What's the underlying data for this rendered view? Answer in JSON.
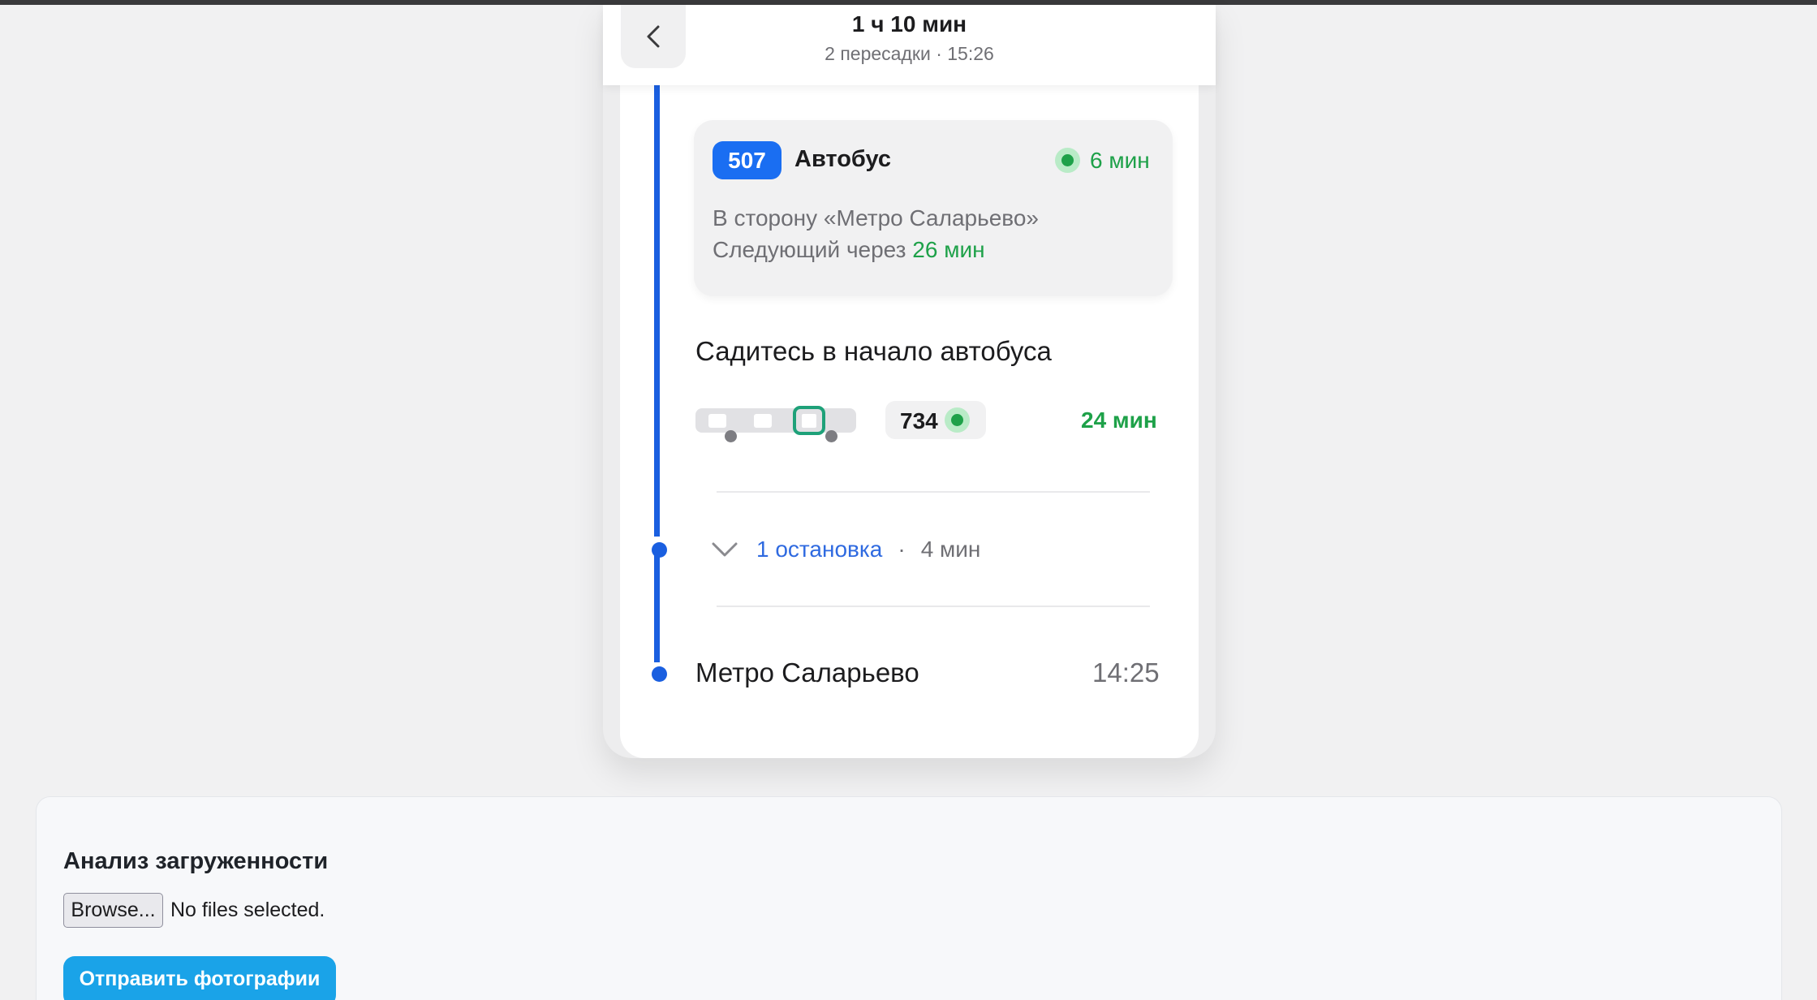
{
  "header": {
    "title": "1 ч 10 мин",
    "subtitle": "2 пересадки · 15:26"
  },
  "bus_card": {
    "route_number": "507",
    "vehicle_type": "Автобус",
    "eta": "6 мин",
    "direction": "В сторону «Метро Саларьево»",
    "next_prefix": "Следующий через",
    "next_time": "26 мин"
  },
  "boarding": {
    "hint": "Садитесь в начало автобуса",
    "vehicle_number": "734",
    "vehicle_eta": "24 мин"
  },
  "stops": {
    "link": "1 остановка",
    "separator": "·",
    "duration": "4 мин"
  },
  "destination": {
    "name": "Метро Саларьево",
    "time": "14:25"
  },
  "analysis": {
    "title": "Анализ загруженности",
    "browse_label": "Browse...",
    "file_status": "No files selected.",
    "submit_label": "Отправить фотографии"
  },
  "colors": {
    "route_blue": "#1a5fe0",
    "badge_blue": "#1a6ef2",
    "live_green": "#1ea149",
    "submit_blue": "#1aa3e8"
  }
}
